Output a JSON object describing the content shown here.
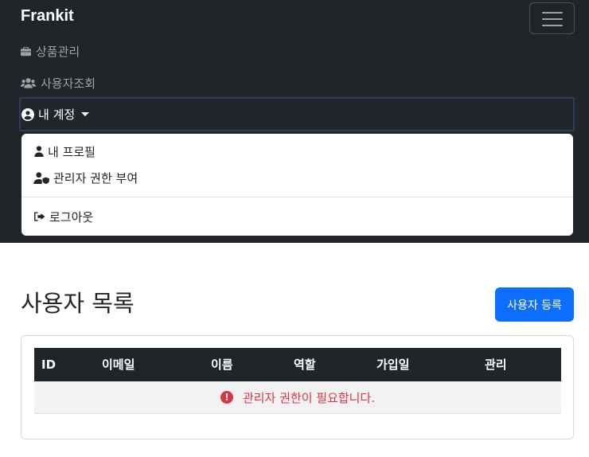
{
  "navbar": {
    "brand": "Frankit",
    "items": [
      {
        "label": "상품관리",
        "icon": "briefcase-icon"
      },
      {
        "label": "사용자조회",
        "icon": "users-icon"
      }
    ],
    "account": {
      "label": "내 계정",
      "icon": "user-circle-icon"
    },
    "dropdown": [
      {
        "label": "내 프로필",
        "icon": "user-icon"
      },
      {
        "label": "관리자 권한 부여",
        "icon": "user-shield-icon"
      },
      {
        "label": "로그아웃",
        "icon": "sign-out-icon"
      }
    ]
  },
  "main": {
    "title": "사용자 목록",
    "add_button": "사용자 등록",
    "table": {
      "headers": [
        "ID",
        "이메일",
        "이름",
        "역할",
        "가입일",
        "관리"
      ],
      "message": "관리자 권한이 필요합니다."
    }
  },
  "colors": {
    "navbar_bg": "#212529",
    "primary": "#0d6efd",
    "danger": "#dc3545"
  }
}
